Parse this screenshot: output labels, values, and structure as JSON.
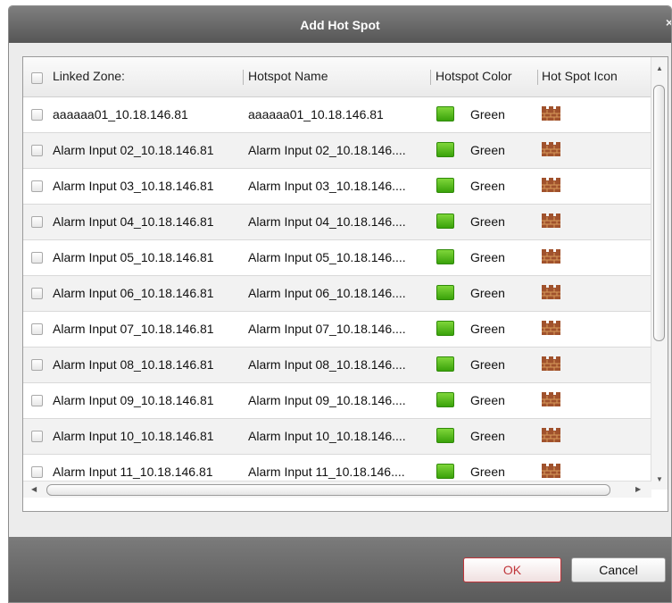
{
  "dialog": {
    "title": "Add Hot Spot",
    "close_glyph": "×"
  },
  "table": {
    "columns": {
      "linked_zone": "Linked Zone:",
      "hotspot_name": "Hotspot Name",
      "hotspot_color": "Hotspot Color",
      "hotspot_icon": "Hot Spot Icon"
    },
    "rows": [
      {
        "zone": "aaaaaa01_10.18.146.81",
        "name": "aaaaaa01_10.18.146.81",
        "color": "Green"
      },
      {
        "zone": "Alarm Input 02_10.18.146.81",
        "name": "Alarm Input 02_10.18.146....",
        "color": "Green"
      },
      {
        "zone": "Alarm Input 03_10.18.146.81",
        "name": "Alarm Input 03_10.18.146....",
        "color": "Green"
      },
      {
        "zone": "Alarm Input 04_10.18.146.81",
        "name": "Alarm Input 04_10.18.146....",
        "color": "Green"
      },
      {
        "zone": "Alarm Input 05_10.18.146.81",
        "name": "Alarm Input 05_10.18.146....",
        "color": "Green"
      },
      {
        "zone": "Alarm Input 06_10.18.146.81",
        "name": "Alarm Input 06_10.18.146....",
        "color": "Green"
      },
      {
        "zone": "Alarm Input 07_10.18.146.81",
        "name": "Alarm Input 07_10.18.146....",
        "color": "Green"
      },
      {
        "zone": "Alarm Input 08_10.18.146.81",
        "name": "Alarm Input 08_10.18.146....",
        "color": "Green"
      },
      {
        "zone": "Alarm Input 09_10.18.146.81",
        "name": "Alarm Input 09_10.18.146....",
        "color": "Green"
      },
      {
        "zone": "Alarm Input 10_10.18.146.81",
        "name": "Alarm Input 10_10.18.146....",
        "color": "Green"
      },
      {
        "zone": "Alarm Input 11_10.18.146.81",
        "name": "Alarm Input 11_10.18.146....",
        "color": "Green"
      }
    ],
    "icon": "castle-icon",
    "swatch_color": "#4fbf1a"
  },
  "buttons": {
    "ok": "OK",
    "cancel": "Cancel"
  },
  "colors": {
    "titlebar": "#666666",
    "ok_accent": "#c0353a"
  }
}
